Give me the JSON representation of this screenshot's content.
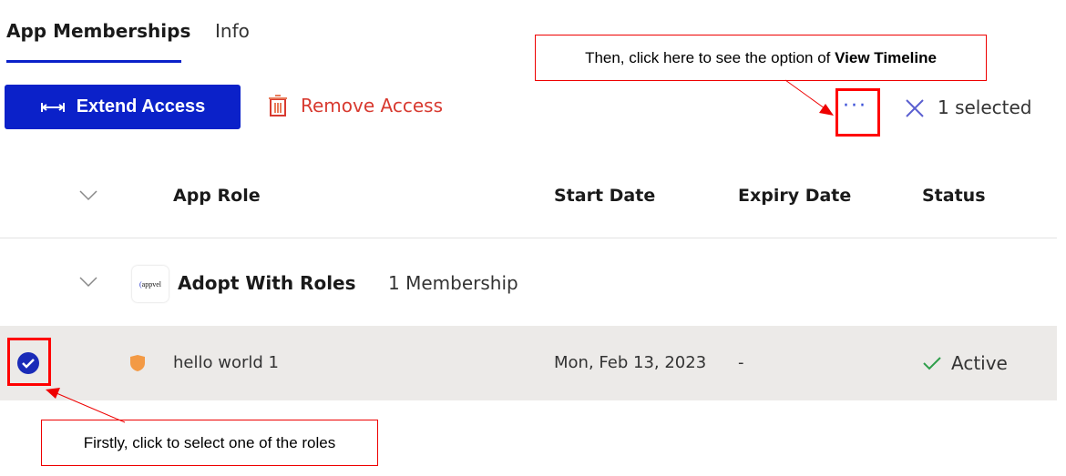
{
  "tabs": [
    {
      "label": "App Memberships",
      "active": true
    },
    {
      "label": "Info",
      "active": false
    }
  ],
  "toolbar": {
    "extend_label": "Extend Access",
    "remove_label": "Remove Access",
    "more_icon": "ellipsis-icon",
    "clear_icon": "close-icon",
    "selected_label": "1 selected"
  },
  "table": {
    "headers": [
      "App Role",
      "Start Date",
      "Expiry Date",
      "Status"
    ],
    "group": {
      "name": "Adopt With Roles",
      "count": "1 Membership",
      "logo_text": "apporelur"
    },
    "rows": [
      {
        "role": "hello world 1",
        "start": "Mon, Feb 13, 2023",
        "expiry": "-",
        "status": "Active",
        "selected": true
      }
    ]
  },
  "annotations": {
    "top_prefix": "Then, click here to see the option of ",
    "top_bold": "View Timeline",
    "bottom": "Firstly, click to select one of the roles"
  },
  "colors": {
    "accent": "#0b21c9",
    "danger": "#d83a30",
    "success": "#2e9e4a",
    "shield": "#f39a45",
    "annotation": "#ff0000"
  }
}
